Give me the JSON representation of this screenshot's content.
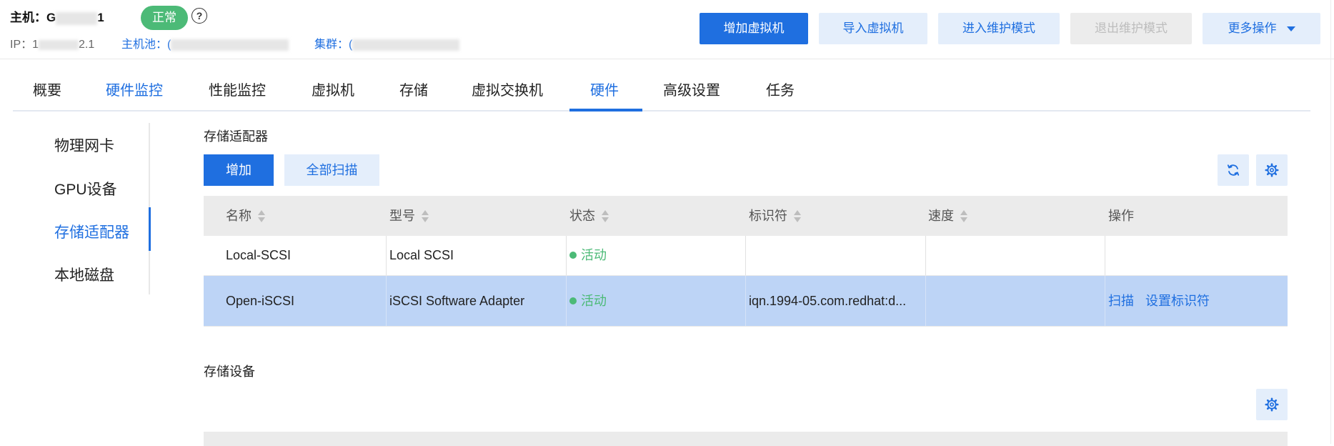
{
  "header": {
    "host_label": "主机：",
    "host_name_visible_start": "G",
    "host_name_visible_end": "1",
    "status": "正常",
    "help_icon": "question-circle-icon",
    "ip_label": "IP：",
    "ip_visible": "1",
    "ip_visible_end": "2.1",
    "pool_label": "主机池：",
    "pool_visible": "(",
    "cluster_label": "集群：",
    "cluster_visible": "("
  },
  "actions": {
    "add_vm": "增加虚拟机",
    "import_vm": "导入虚拟机",
    "enter_maintenance": "进入维护模式",
    "exit_maintenance": "退出维护模式",
    "more": "更多操作"
  },
  "tabs": [
    "概要",
    "硬件监控",
    "性能监控",
    "虚拟机",
    "存储",
    "虚拟交换机",
    "硬件",
    "高级设置",
    "任务"
  ],
  "active_tab": "硬件",
  "side_nav": [
    "物理网卡",
    "GPU设备",
    "存储适配器",
    "本地磁盘"
  ],
  "active_side_nav": "存储适配器",
  "adapters_section": {
    "title": "存储适配器",
    "add_button": "增加",
    "scan_all_button": "全部扫描",
    "refresh_icon": "refresh-icon",
    "settings_icon": "gear-icon",
    "columns": [
      "名称",
      "型号",
      "状态",
      "标识符",
      "速度",
      "操作"
    ],
    "rows": [
      {
        "name": "Local-SCSI",
        "model": "Local SCSI",
        "status": "活动",
        "identifier": "",
        "speed": "",
        "ops": []
      },
      {
        "name": "Open-iSCSI",
        "model": "iSCSI Software Adapter",
        "status": "活动",
        "identifier": "iqn.1994-05.com.redhat:d...",
        "speed": "",
        "ops": [
          "扫描",
          "设置标识符"
        ]
      }
    ]
  },
  "devices_section": {
    "title": "存储设备",
    "settings_icon": "gear-icon"
  },
  "colors": {
    "primary": "#1f6fe0",
    "light_button": "#e4eefb",
    "status_green": "#4cba77",
    "selected_row": "#bdd4f6",
    "table_header": "#ebebeb"
  }
}
